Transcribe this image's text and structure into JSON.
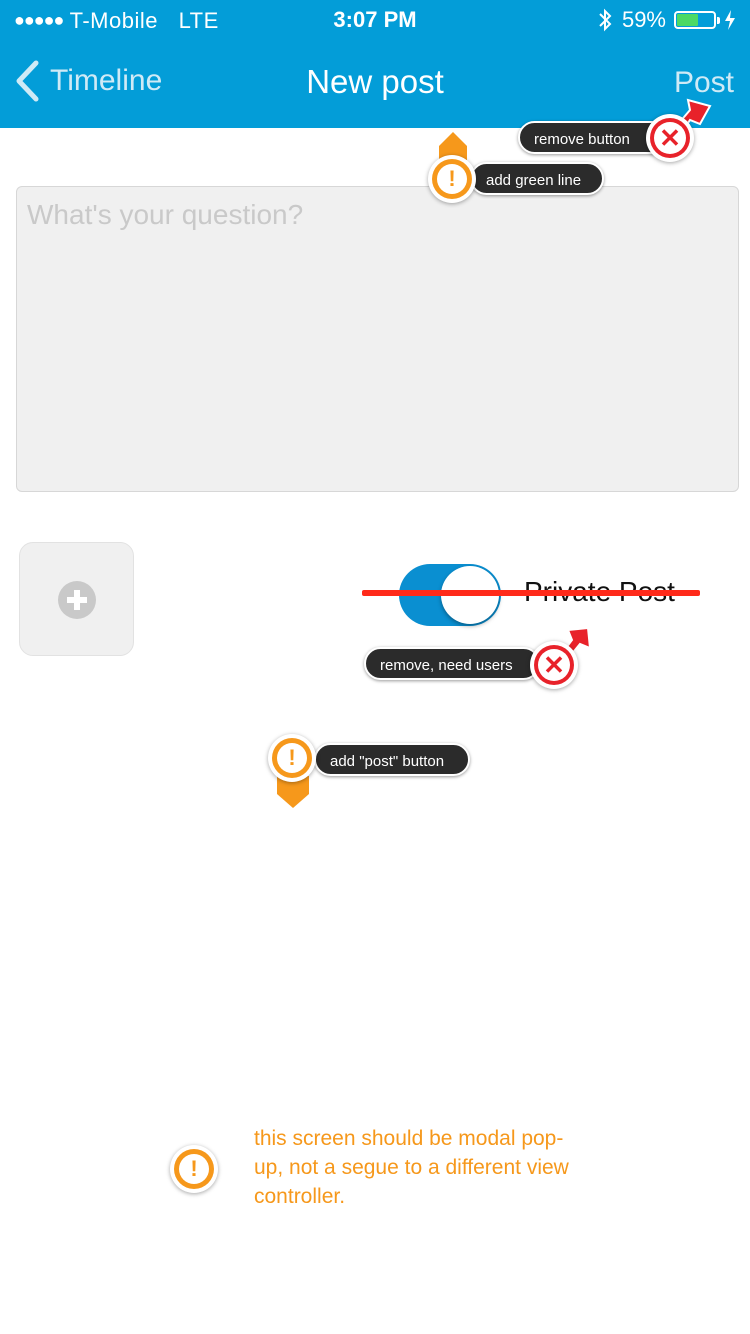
{
  "status_bar": {
    "signal_dots": "●●●●●",
    "carrier": "T-Mobile",
    "network": "LTE",
    "time": "3:07 PM",
    "bluetooth_icon": "bluetooth-icon",
    "battery_percent": "59%",
    "battery_level": 0.59
  },
  "nav": {
    "back_label": "Timeline",
    "title": "New post",
    "post_label": "Post"
  },
  "compose": {
    "placeholder": "What's your question?",
    "value": ""
  },
  "photo_button": {
    "icon": "plus-circle-icon"
  },
  "privacy": {
    "toggle_on": true,
    "label": "Private Post"
  },
  "annotations": {
    "remove_button": "remove button",
    "add_green_line": "add green line",
    "remove_need_users": "remove, need users",
    "add_post_button": "add \"post\" button",
    "modal_note": "this screen should be modal pop-up, not a segue to a different view controller."
  },
  "colors": {
    "header": "#039dd8",
    "toggle": "#0a8fd1",
    "warning": "#f6981b",
    "error": "#e8222a",
    "strike": "#ff2a1a"
  }
}
